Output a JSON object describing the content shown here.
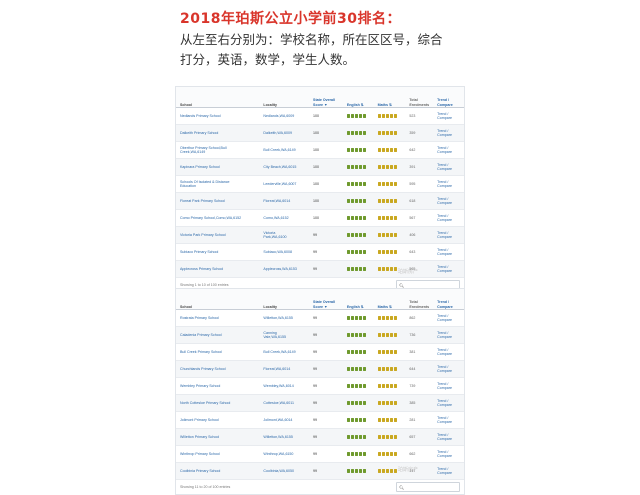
{
  "header": {
    "title": "2018年珀斯公立小学前30排名：",
    "desc_line1": "从左至右分别为：学校名称，所在区区号，综合",
    "desc_line2": "打分，英语，数学，学生人数。"
  },
  "columns": {
    "school": "School",
    "locality": "Locality",
    "score1": "State Overall",
    "score2": "Score ▼",
    "english": "English ⇅",
    "maths": "Maths ⇅",
    "enrol1": "Total",
    "enrol2": "Enrolments",
    "trend1": "Trend /",
    "trend2": "Compare"
  },
  "trend": {
    "line1": "Trend /",
    "line2": "Compare"
  },
  "colors": {
    "title_red": "#d9352b",
    "link_blue": "#2a67a8",
    "english_green": "#6f9a2e",
    "maths_gold": "#c9a820"
  },
  "table1": {
    "rows": [
      {
        "school": [
          "Nedlands Primary School"
        ],
        "locality": [
          "Nedlands,WA,6009"
        ],
        "score": "100",
        "english": 5,
        "maths": 5,
        "enrol": "523"
      },
      {
        "school": [
          "Dalkeith Primary School"
        ],
        "locality": [
          "Dalkeith,WA,6009"
        ],
        "score": "100",
        "english": 5,
        "maths": 5,
        "enrol": "359"
      },
      {
        "school": [
          "Oberthur Primary School,Bull",
          "Creek,WA,6149"
        ],
        "locality": [
          "Bull Creek,WA,6149"
        ],
        "score": "100",
        "english": 5,
        "maths": 5,
        "enrol": "642"
      },
      {
        "school": [
          "Kapinara Primary School"
        ],
        "locality": [
          "City Beach,WA,6015"
        ],
        "score": "100",
        "english": 5,
        "maths": 5,
        "enrol": "391"
      },
      {
        "school": [
          "Schools Of Isolated & Distance",
          "Education"
        ],
        "locality": [
          "Leederville,WA,6007"
        ],
        "score": "100",
        "english": 5,
        "maths": 5,
        "enrol": "595"
      },
      {
        "school": [
          "Floreat Park Primary School"
        ],
        "locality": [
          "Floreat,WA,6014"
        ],
        "score": "100",
        "english": 5,
        "maths": 5,
        "enrol": "618"
      },
      {
        "school": [
          "Como Primary School,Como,WA,6152"
        ],
        "locality": [
          "Como,WA,6152"
        ],
        "score": "100",
        "english": 5,
        "maths": 5,
        "enrol": "567"
      },
      {
        "school": [
          "Victoria Park Primary School"
        ],
        "locality": [
          "Victoria",
          "Park,WA,6100"
        ],
        "score": "99",
        "english": 5,
        "maths": 5,
        "enrol": "406"
      },
      {
        "school": [
          "Subiaco Primary School"
        ],
        "locality": [
          "Subiaco,WA,6008"
        ],
        "score": "99",
        "english": 5,
        "maths": 5,
        "enrol": "643"
      },
      {
        "school": [
          "Applecross Primary School"
        ],
        "locality": [
          "Applecross,WA,6153"
        ],
        "score": "99",
        "english": 5,
        "maths": 5,
        "enrol": "565"
      }
    ],
    "footer": "Showing 1 to 10 of 100 entries"
  },
  "table2": {
    "rows": [
      {
        "school": [
          "Rostrata Primary School"
        ],
        "locality": [
          "Willetton,WA,6155"
        ],
        "score": "99",
        "english": 5,
        "maths": 5,
        "enrol": "862"
      },
      {
        "school": [
          "Caladenia Primary School"
        ],
        "locality": [
          "Canning",
          "Vale,WA,6155"
        ],
        "score": "99",
        "english": 5,
        "maths": 5,
        "enrol": "736"
      },
      {
        "school": [
          "Bull Creek Primary School"
        ],
        "locality": [
          "Bull Creek,WA,6149"
        ],
        "score": "99",
        "english": 5,
        "maths": 5,
        "enrol": "381"
      },
      {
        "school": [
          "Churchlands Primary School"
        ],
        "locality": [
          "Floreat,WA,6014"
        ],
        "score": "99",
        "english": 5,
        "maths": 5,
        "enrol": "644"
      },
      {
        "school": [
          "Wembley Primary School"
        ],
        "locality": [
          "Wembley,WA,6014"
        ],
        "score": "99",
        "english": 5,
        "maths": 5,
        "enrol": "739"
      },
      {
        "school": [
          "North Cottesloe Primary School"
        ],
        "locality": [
          "Cottesloe,WA,6011"
        ],
        "score": "99",
        "english": 5,
        "maths": 5,
        "enrol": "385"
      },
      {
        "school": [
          "Jolimont Primary School"
        ],
        "locality": [
          "Jolimont,WA,6014"
        ],
        "score": "99",
        "english": 5,
        "maths": 5,
        "enrol": "281"
      },
      {
        "school": [
          "Willetton Primary School"
        ],
        "locality": [
          "Willetton,WA,6155"
        ],
        "score": "99",
        "english": 5,
        "maths": 5,
        "enrol": "657"
      },
      {
        "school": [
          "Winthrop Primary School"
        ],
        "locality": [
          "Winthrop,WA,6150"
        ],
        "score": "99",
        "english": 5,
        "maths": 5,
        "enrol": "662"
      },
      {
        "school": [
          "Coolbinia Primary School"
        ],
        "locality": [
          "Coolbinia,WA,6050"
        ],
        "score": "99",
        "english": 5,
        "maths": 5,
        "enrol": "447"
      }
    ],
    "footer": "Showing 11 to 20 of 100 entries"
  },
  "search_icon": "search-icon",
  "watermark": "珀斯房产"
}
